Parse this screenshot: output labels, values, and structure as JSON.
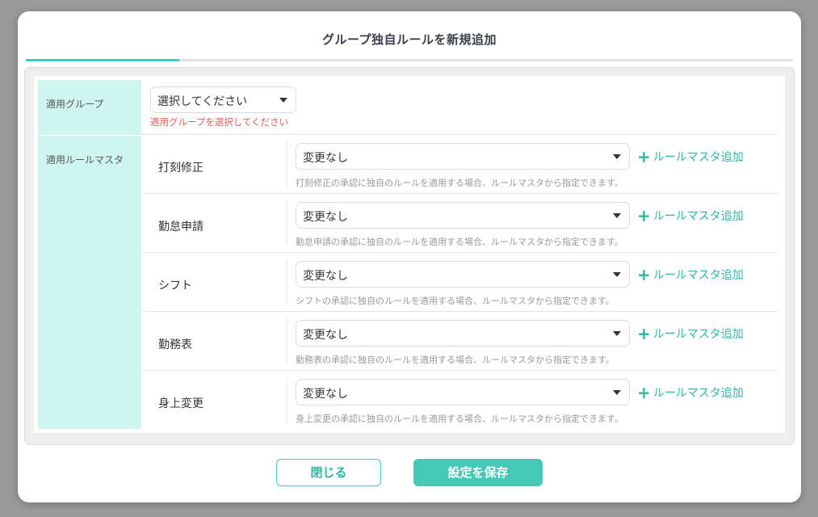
{
  "dialog": {
    "title": "グループ独自ルールを新規追加"
  },
  "group": {
    "label": "適用グループ",
    "selected": "選択してください",
    "error": "適用グループを選択してください"
  },
  "rules": {
    "section_label": "適用ルールマスタ",
    "add_label": "ルールマスタ追加",
    "items": [
      {
        "name": "打刻修正",
        "selected": "変更なし",
        "hint": "打刻修正の承認に独自のルールを適用する場合、ルールマスタから指定できます。"
      },
      {
        "name": "勤怠申請",
        "selected": "変更なし",
        "hint": "勤怠申請の承認に独自のルールを適用する場合、ルールマスタから指定できます。"
      },
      {
        "name": "シフト",
        "selected": "変更なし",
        "hint": "シフトの承認に独自のルールを適用する場合、ルールマスタから指定できます。"
      },
      {
        "name": "勤務表",
        "selected": "変更なし",
        "hint": "勤務表の承認に独自のルールを適用する場合、ルールマスタから指定できます。"
      },
      {
        "name": "身上変更",
        "selected": "変更なし",
        "hint": "身上変更の承認に独自のルールを適用する場合、ルールマスタから指定できます。"
      }
    ]
  },
  "buttons": {
    "close": "閉じる",
    "save": "設定を保存"
  },
  "colors": {
    "accent": "#45c8b5",
    "label_bg": "#cff5ef",
    "error": "#e85a5a"
  }
}
